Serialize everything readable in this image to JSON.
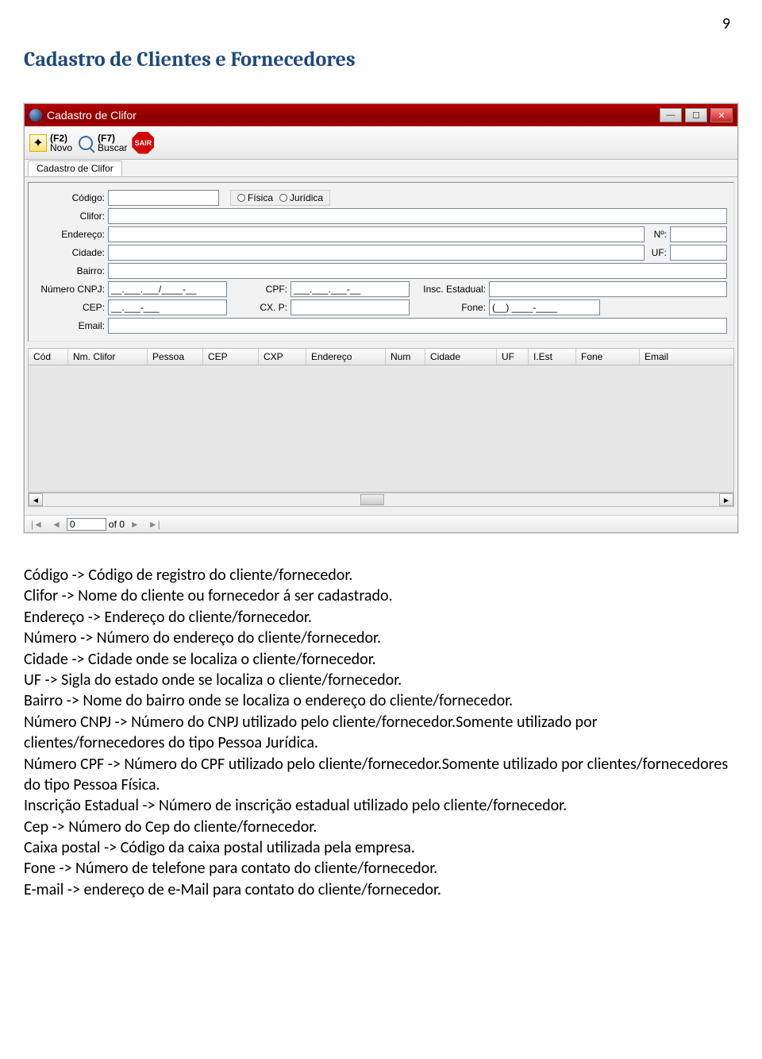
{
  "page": {
    "number": "9"
  },
  "heading": "Cadastro de Clientes e Fornecedores",
  "window": {
    "title": "Cadastro de Clifor",
    "toolbar": {
      "novo": {
        "shortcut": "(F2)",
        "label": "Novo"
      },
      "buscar": {
        "shortcut": "(F7)",
        "label": "Buscar"
      },
      "sair": "SAIR"
    },
    "tab": "Cadastro de Clifor",
    "form": {
      "codigo_label": "Código:",
      "pessoa": {
        "fisica": "Física",
        "juridica": "Jurídica"
      },
      "clifor_label": "Clifor:",
      "endereco_label": "Endereço:",
      "numero_label": "Nº:",
      "cidade_label": "Cidade:",
      "uf_label": "UF:",
      "bairro_label": "Bairro:",
      "cnpj_label": "Número CNPJ:",
      "cnpj_mask": "__.___.___/____-__",
      "cpf_label": "CPF:",
      "cpf_mask": "___.___.___-__",
      "insc_label": "Insc. Estadual:",
      "cep_label": "CEP:",
      "cep_mask": "__.___-___",
      "cxp_label": "CX. P:",
      "fone_label": "Fone:",
      "fone_mask": "(__) ____-____",
      "email_label": "Email:"
    },
    "grid": {
      "cols": [
        "Cód",
        "Nm. Clifor",
        "Pessoa",
        "CEP",
        "CXP",
        "Endereço",
        "Num",
        "Cidade",
        "UF",
        "I.Est",
        "Fone",
        "Email"
      ]
    },
    "nav": {
      "current": "0",
      "of_label": "of 0"
    }
  },
  "body": {
    "l1": "Código -> Código de registro do cliente/fornecedor.",
    "l2": "Clifor -> Nome do cliente ou fornecedor á ser cadastrado.",
    "l3": "Endereço -> Endereço do cliente/fornecedor.",
    "l4": "Número -> Número do endereço do cliente/fornecedor.",
    "l5": "Cidade -> Cidade onde se localiza o cliente/fornecedor.",
    "l6": "UF -> Sigla do estado onde se localiza o cliente/fornecedor.",
    "l7": "Bairro -> Nome do bairro onde se localiza o endereço do cliente/fornecedor.",
    "l8": "Número CNPJ -> Número do CNPJ utilizado pelo cliente/fornecedor.Somente utilizado por clientes/fornecedores do tipo Pessoa Jurídica.",
    "l9": "Número CPF -> Número do CPF utilizado pelo cliente/fornecedor.Somente utilizado por clientes/fornecedores do tipo Pessoa Física.",
    "l10": "Inscrição Estadual -> Número de inscrição estadual utilizado pelo cliente/fornecedor.",
    "l11": "Cep -> Número do Cep do cliente/fornecedor.",
    "l12": "Caixa postal -> Código da caixa postal utilizada pela empresa.",
    "l13": "Fone -> Número de telefone para contato do cliente/fornecedor.",
    "l14": "E-mail -> endereço de e-Mail para contato do cliente/fornecedor."
  }
}
